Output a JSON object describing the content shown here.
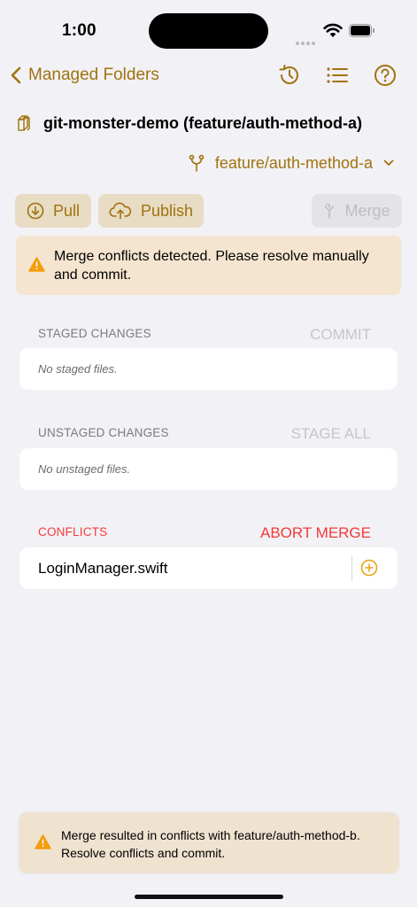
{
  "status_bar": {
    "time": "1:00"
  },
  "nav": {
    "back_label": "Managed Folders",
    "icons": [
      "history-icon",
      "list-icon",
      "help-icon"
    ]
  },
  "repo": {
    "title": "git-monster-demo (feature/auth-method-a)",
    "icon": "repo-icon"
  },
  "branch": {
    "name": "feature/auth-method-a"
  },
  "actions": {
    "pull": "Pull",
    "publish": "Publish",
    "merge": "Merge"
  },
  "banner": {
    "message": "Merge conflicts detected. Please resolve manually and commit."
  },
  "staged": {
    "header": "STAGED CHANGES",
    "action": "COMMIT",
    "empty": "No staged files."
  },
  "unstaged": {
    "header": "UNSTAGED CHANGES",
    "action": "STAGE ALL",
    "empty": "No unstaged files."
  },
  "conflicts": {
    "header": "CONFLICTS",
    "action": "ABORT MERGE",
    "files": [
      "LoginManager.swift"
    ]
  },
  "toast": {
    "message": "Merge resulted in conflicts with feature/auth-method-b. Resolve conflicts and commit."
  },
  "colors": {
    "accent": "#a0730d",
    "danger": "#f23b37",
    "warning": "#f29d0a",
    "background": "#f2f1f6"
  }
}
